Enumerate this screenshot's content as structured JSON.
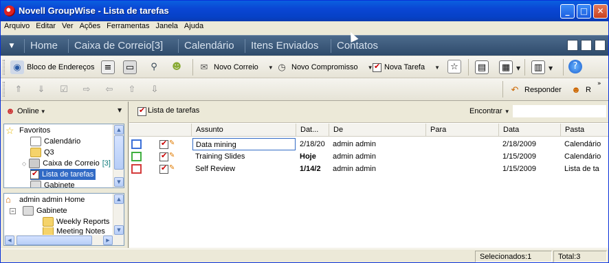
{
  "window": {
    "title": "Novell GroupWise - Lista de tarefas",
    "min": "_",
    "max": "□",
    "close": "✕"
  },
  "menu": [
    "Arquivo",
    "Editar",
    "Ver",
    "Ações",
    "Ferramentas",
    "Janela",
    "Ajuda"
  ],
  "nav": {
    "tabs": [
      "Home",
      "Caixa de Correio[3]",
      "Calendário",
      "Itens Enviados",
      "Contatos"
    ]
  },
  "toolbar1": {
    "address_book": "Bloco de Endereços",
    "new_mail": "Novo Correio",
    "new_appointment": "Novo Compromisso",
    "new_task": "Nova Tarefa"
  },
  "toolbar2": {
    "reply": "Responder",
    "forward_truncated": "R"
  },
  "left": {
    "online": "Online",
    "folders": [
      {
        "label": "Favoritos",
        "icon": "star-icon"
      },
      {
        "label": "Calendário",
        "icon": "calendar-icon"
      },
      {
        "label": "Q3",
        "icon": "folder-icon"
      },
      {
        "label": "Caixa de Correio",
        "badge": "[3]",
        "icon": "mailbox-icon"
      },
      {
        "label": "Lista de tarefas",
        "icon": "task-list-icon"
      },
      {
        "label": "Gabinete",
        "icon": "cabinet-icon"
      }
    ],
    "tree": [
      {
        "label": "admin admin Home",
        "icon": "home-icon"
      },
      {
        "label": "Gabinete",
        "icon": "cabinet-icon"
      },
      {
        "label": "Weekly Reports",
        "icon": "folder-icon"
      },
      {
        "label": "Meeting Notes",
        "icon": "folder-icon"
      }
    ]
  },
  "main": {
    "title": "Lista de tarefas",
    "find": "Encontrar",
    "columns": [
      "Assunto",
      "Dat...",
      "De",
      "Para",
      "Data",
      "Pasta"
    ],
    "rows": [
      {
        "subject": "Data mining",
        "due": "2/18/20",
        "from": "admin admin",
        "to": "",
        "date": "2/18/2009",
        "folder": "Calendário",
        "color": "#3a6fd8"
      },
      {
        "subject": "Training Slides",
        "due": "Hoje",
        "from": "admin admin",
        "to": "",
        "date": "1/15/2009",
        "folder": "Calendário",
        "color": "#3fae3f"
      },
      {
        "subject": "Self Review",
        "due": "1/14/2",
        "from": "admin admin",
        "to": "",
        "date": "1/15/2009",
        "folder": "Lista de ta",
        "color": "#d43a3a"
      }
    ]
  },
  "status": {
    "selected": "Selecionados:1",
    "total": "Total:3"
  }
}
